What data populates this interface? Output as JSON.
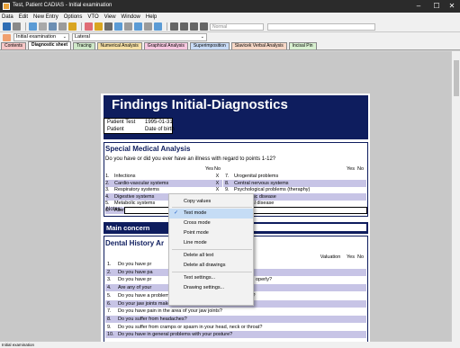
{
  "window": {
    "title": "Test, Patient CADIAS - Initial examination",
    "controls": [
      "–",
      "☐",
      "✕"
    ]
  },
  "menu": [
    "Data",
    "Edit",
    "New Entry",
    "Options",
    "VTO",
    "View",
    "Window",
    "Help"
  ],
  "toolbar": {
    "font_placeholder": "Normal",
    "colors": [
      "#2e6db4",
      "#8a8a8a",
      "#5b9bd5",
      "#a9a9a9",
      "#6d8fb3",
      "#9b9b9b",
      "#d9a521",
      "#e06c75",
      "#d9a521",
      "#6b6b6b",
      "#5b9bd5",
      "#9b9b9b",
      "#5b9bd5",
      "#9b9b9b",
      "#5b9bd5",
      "#d9a521"
    ]
  },
  "context_bar": {
    "exam_value": "Initial examination",
    "view_value": "Lateral"
  },
  "tabs": [
    {
      "label": "Contents",
      "color": "#f7c7c7"
    },
    {
      "label": "Diagnostic sheet",
      "color": "#ffffff",
      "active": true
    },
    {
      "label": "Tracing",
      "color": "#cfe8c8"
    },
    {
      "label": "Numerical Analysis",
      "color": "#f7e1a6"
    },
    {
      "label": "Graphical Analysis",
      "color": "#f7c7e0"
    },
    {
      "label": "Superimposition",
      "color": "#c9dcf7"
    },
    {
      "label": "Slavicek Verbal Analysis",
      "color": "#f7d8c7"
    },
    {
      "label": "Incisal Pin",
      "color": "#d8f0d0"
    }
  ],
  "document": {
    "title": "Findings Initial-Diagnostics",
    "patient_name": "Patient Test",
    "patient_label": "Patient",
    "dob_value": "1995-01-31",
    "dob_label": "Date of birth",
    "sma_title": "Special Medical Analysis",
    "sma_question": "Do you have or did you ever have an illness with regard to points 1-12?",
    "yes": "Yes",
    "no": "No",
    "left_items": [
      {
        "n": "1.",
        "t": "Infections",
        "no": "X"
      },
      {
        "n": "2.",
        "t": "Cardio-vascular systems",
        "no": "X"
      },
      {
        "n": "3.",
        "t": "Respiratory systems",
        "no": "X"
      },
      {
        "n": "4.",
        "t": "Digestive systems",
        "no": "X"
      },
      {
        "n": "5.",
        "t": "Metabolic systems",
        "no": "X"
      },
      {
        "n": "6.",
        "t": "Allergies",
        "no": ""
      }
    ],
    "right_items": [
      {
        "n": "7.",
        "t": "Urogenital problems"
      },
      {
        "n": "8.",
        "t": "Central nervous systems"
      },
      {
        "n": "9.",
        "t": "Psychological problems (theraphy)"
      },
      {
        "n": "10.",
        "t": "Rheumatic disease"
      },
      {
        "n": "11.",
        "t": "Hormonal disease"
      },
      {
        "n": "",
        "t": "problems"
      }
    ],
    "notes_label": "Notes:",
    "main_concern": "Main concern",
    "dental_title": "Dental History Ar",
    "valuation_header": "Valuation",
    "dental_items": [
      {
        "n": "1.",
        "t": "Do you have pr"
      },
      {
        "n": "2.",
        "t": "Do you have pa"
      },
      {
        "n": "3.",
        "t": "Do you have pr",
        "tail": "operly?"
      },
      {
        "n": "4.",
        "t": "Are any of your"
      },
      {
        "n": "5.",
        "t": "Do you have a problem when you open your mouth very wide?"
      },
      {
        "n": "6.",
        "t": "Do your jaw joints make noise and if so, on what side?"
      },
      {
        "n": "7.",
        "t": "Do you have pain in the area of your jaw joints?"
      },
      {
        "n": "8.",
        "t": "Do you suffer from headaches?"
      },
      {
        "n": "9.",
        "t": "Do you suffer from cramps or spasm in your head, neck or throat?"
      },
      {
        "n": "10.",
        "t": "Do you have in general problems with your posture?"
      }
    ]
  },
  "context_menu": {
    "items": [
      {
        "label": "Copy values"
      },
      {
        "label": "Text mode",
        "checked": true,
        "selected": true
      },
      {
        "label": "Cross mode"
      },
      {
        "label": "Point mode"
      },
      {
        "label": "Line mode"
      },
      {
        "label": "Delete all text"
      },
      {
        "label": "Delete all drawings"
      },
      {
        "label": "Text settings..."
      },
      {
        "label": "Drawing settings..."
      }
    ]
  },
  "status": "Initial examination"
}
